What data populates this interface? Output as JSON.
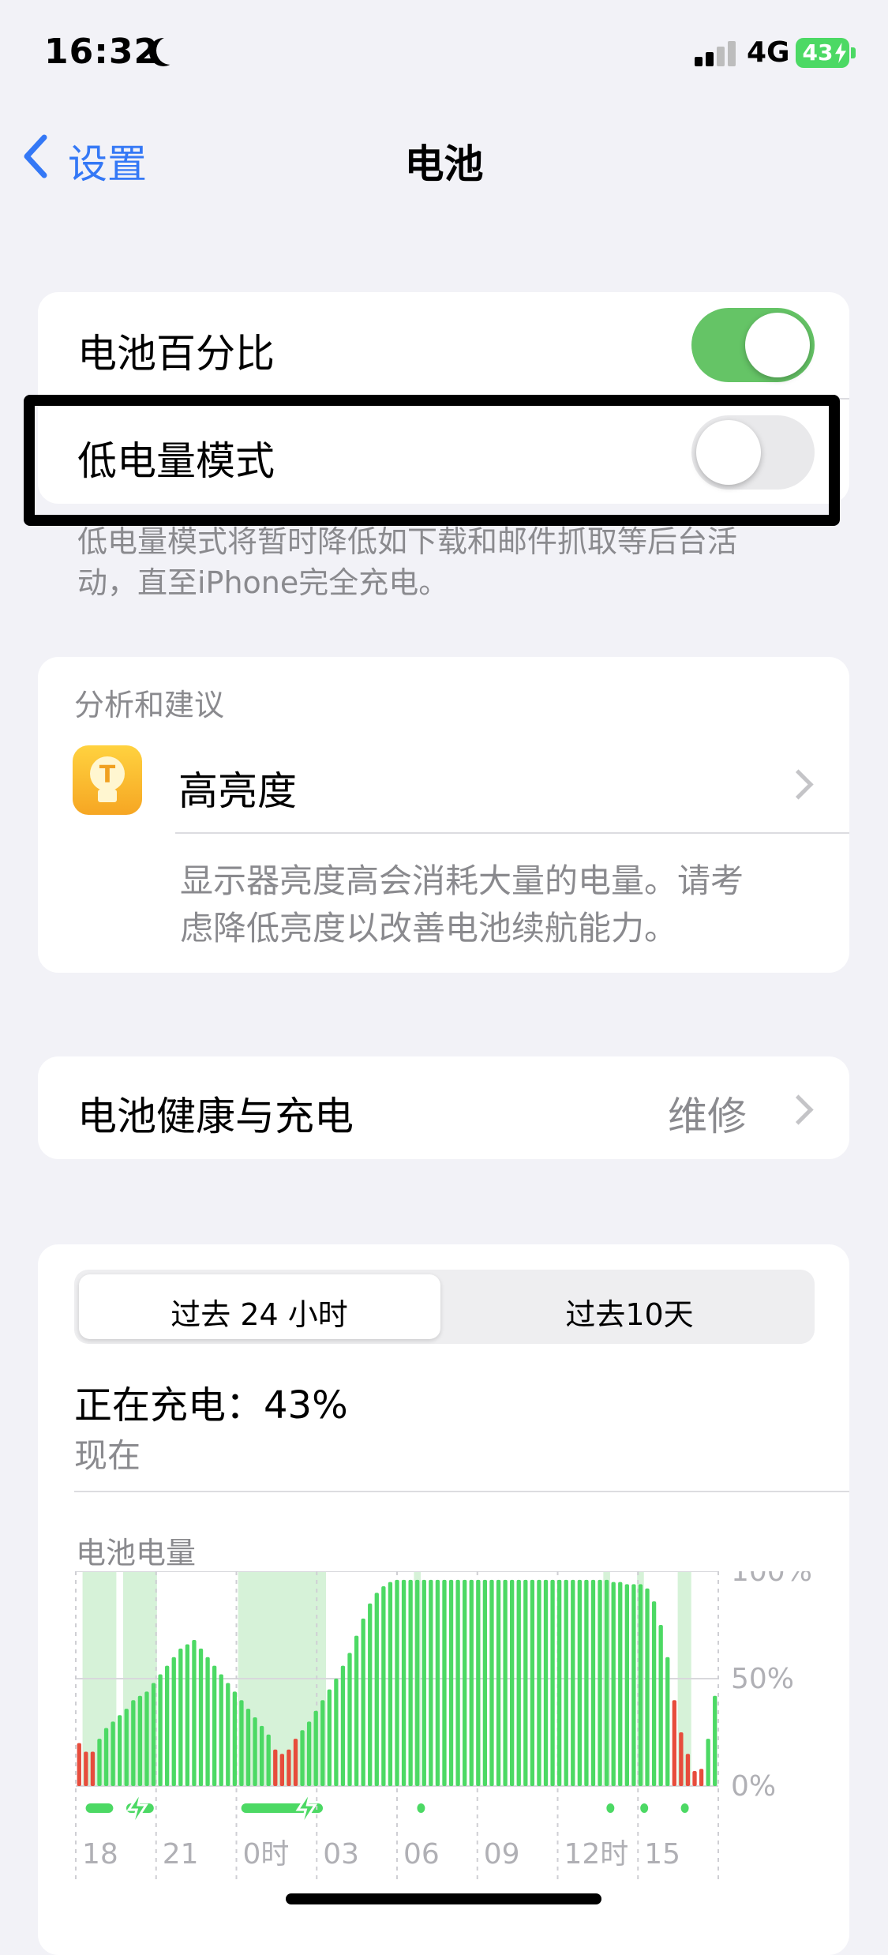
{
  "status_bar": {
    "time": "16:32",
    "network": "4G",
    "battery_level": "43"
  },
  "nav": {
    "back_label": "设置",
    "title": "电池"
  },
  "settings": {
    "battery_percentage_label": "电池百分比",
    "battery_percentage_on": true,
    "low_power_label": "低电量模式",
    "low_power_on": false,
    "low_power_footnote_line1": "低电量模式将暂时降低如下载和邮件抓取等后台活",
    "low_power_footnote_line2": "动，直至iPhone完全充电。"
  },
  "insights": {
    "header": "分析和建议",
    "item_title": "高亮度",
    "item_desc_line1": "显示器亮度高会消耗大量的电量。请考",
    "item_desc_line2": "虑降低亮度以改善电池续航能力。"
  },
  "health": {
    "label": "电池健康与充电",
    "value": "维修"
  },
  "usage": {
    "tabs": [
      "过去 24 小时",
      "过去10天"
    ],
    "active_tab": 0,
    "status_title": "正在充电：43%",
    "status_subtitle": "现在"
  },
  "colors": {
    "accent": "#3478f6",
    "green": "#65c466",
    "bar_green": "#4cd964",
    "bar_red": "#e74c3c",
    "charge_band": "#d6f2d8"
  },
  "chart_data": {
    "type": "bar",
    "title": "电池电量",
    "x_tick_labels": [
      "18",
      "21",
      "0时",
      "03",
      "06",
      "09",
      "12时",
      "15"
    ],
    "y_tick_labels": [
      "100%",
      "50%",
      "0%"
    ],
    "ylim": [
      0,
      100
    ],
    "values": [
      20,
      16,
      16,
      22,
      27,
      30,
      33,
      36,
      40,
      42,
      44,
      48,
      52,
      56,
      60,
      64,
      66,
      68,
      64,
      60,
      56,
      52,
      48,
      44,
      40,
      36,
      32,
      28,
      24,
      17,
      15,
      17,
      22,
      26,
      30,
      35,
      40,
      45,
      50,
      56,
      62,
      70,
      78,
      85,
      90,
      93,
      95,
      96,
      96,
      96,
      96,
      96,
      96,
      96,
      96,
      96,
      96,
      96,
      96,
      96,
      96,
      96,
      96,
      96,
      96,
      96,
      96,
      96,
      96,
      96,
      96,
      96,
      96,
      96,
      96,
      96,
      96,
      96,
      96,
      95,
      95,
      94,
      94,
      94,
      92,
      86,
      75,
      60,
      40,
      25,
      15,
      7,
      8,
      22,
      42
    ],
    "red_bar_indices": [
      0,
      1,
      2,
      29,
      30,
      31,
      32,
      88,
      89,
      90,
      91,
      92
    ],
    "charging_periods": [
      [
        1,
        5
      ],
      [
        7,
        11
      ],
      [
        24,
        36
      ],
      [
        50,
        50
      ],
      [
        78,
        78
      ],
      [
        83,
        83
      ],
      [
        89,
        90
      ]
    ],
    "grid": true
  }
}
